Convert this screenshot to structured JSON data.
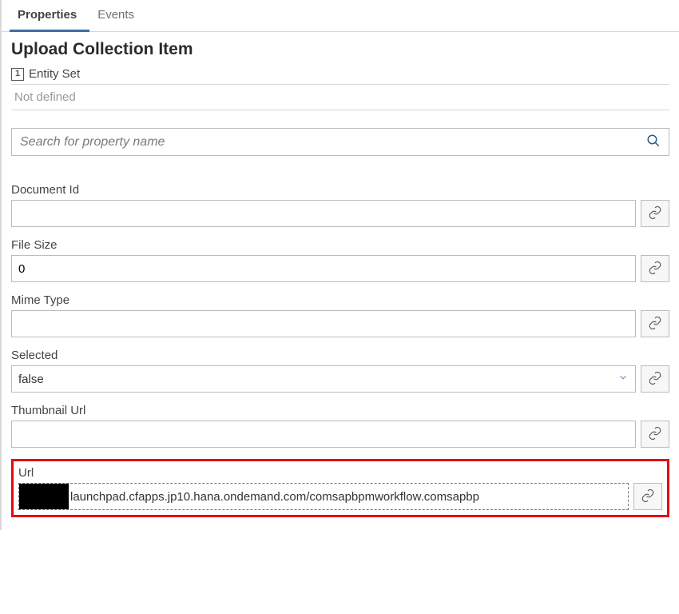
{
  "tabs": {
    "properties": "Properties",
    "events": "Events"
  },
  "header": {
    "title": "Upload Collection Item",
    "entity_label": "Entity Set",
    "entity_value": "Not defined",
    "entity_icon_text": "1"
  },
  "search": {
    "placeholder": "Search for property name"
  },
  "fields": {
    "documentId": {
      "label": "Document Id",
      "value": ""
    },
    "fileSize": {
      "label": "File Size",
      "value": "0"
    },
    "mimeType": {
      "label": "Mime Type",
      "value": ""
    },
    "selected": {
      "label": "Selected",
      "value": "false"
    },
    "thumbnailUrl": {
      "label": "Thumbnail Url",
      "value": ""
    },
    "url": {
      "label": "Url",
      "value": "launchpad.cfapps.jp10.hana.ondemand.com/comsapbpmworkflow.comsapbp"
    }
  }
}
